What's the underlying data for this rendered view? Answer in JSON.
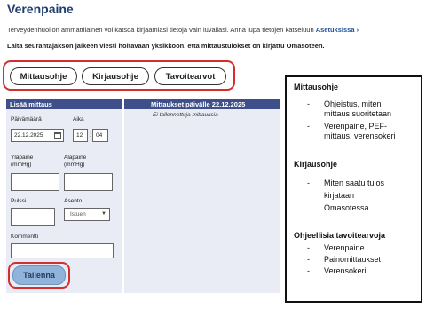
{
  "page": {
    "title": "Verenpaine",
    "info_text": "Terveydenhuollon ammattilainen voi katsoa kirjaamiasi tietoja vain luvallasi. Anna lupa tietojen katseluun",
    "info_link": "Asetuksissa",
    "notice": "Laita seurantajakson jälkeen viesti hoitavaan yksikköön, että mittaustulokset on kirjattu Omasoteen."
  },
  "tabs": [
    {
      "label": "Mittausohje"
    },
    {
      "label": "Kirjausohje"
    },
    {
      "label": "Tavoitearvot"
    }
  ],
  "add_form": {
    "header": "Lisää mittaus",
    "date_label": "Päivämäärä",
    "date_value": "22.12.2025",
    "time_label": "Aika",
    "hour_value": "12",
    "minute_value": "04",
    "time_separator": ":",
    "systolic_label_1": "Yläpaine",
    "systolic_label_2": "(mmHg)",
    "diastolic_label_1": "Alapaine",
    "diastolic_label_2": "(mmHg)",
    "pulse_label": "Pulssi",
    "position_label": "Asento",
    "position_value": "Istuen",
    "comment_label": "Kommentti",
    "save_label": "Tallenna"
  },
  "measurements": {
    "header": "Mittaukset päivälle 22.12.2025",
    "empty_text": "Ei tallennettuja mittauksia"
  },
  "guide": {
    "section1_title": "Mittausohje",
    "section1_items": [
      "Ohjeistus, miten",
      "mittaus suoritetaan",
      "Verenpaine, PEF-",
      "mittaus, verensokeri"
    ],
    "section2_title": "Kirjausohje",
    "section2_items": [
      "Miten saatu tulos",
      "kirjataan",
      "Omasotessa"
    ],
    "section3_title": "Ohjeellisia tavoitearvoja",
    "section3_items": [
      "Verenpaine",
      "Painomittaukset",
      "Verensokeri"
    ]
  },
  "colors": {
    "title": "#1f3d6e",
    "panel_header": "#3e4f8a",
    "panel_bg": "#e9ecf5",
    "highlight": "#d32f2f",
    "save_button": "#8fb3d9"
  },
  "icons": {
    "link_arrow": "chevron-right-icon",
    "date_picker": "calendar-icon",
    "select": "chevron-down-icon"
  }
}
